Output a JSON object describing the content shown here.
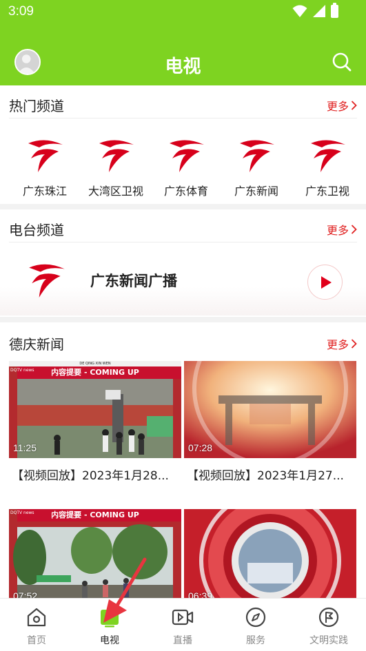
{
  "status": {
    "time": "3:09"
  },
  "header": {
    "title": "电视"
  },
  "hot_channels": {
    "title": "热门频道",
    "more": "更多",
    "items": [
      {
        "label": "广东珠江"
      },
      {
        "label": "大湾区卫视"
      },
      {
        "label": "广东体育"
      },
      {
        "label": "广东新闻"
      },
      {
        "label": "广东卫视"
      }
    ]
  },
  "radio": {
    "title": "电台频道",
    "more": "更多",
    "station": "广东新闻广播"
  },
  "news": {
    "title": "德庆新闻",
    "more": "更多",
    "banner_text": "内容提要 - COMING UP",
    "banner_small": "DE QING XIN WEN",
    "logo_text": "DQTV news",
    "items": [
      {
        "duration": "11:25",
        "title": "【视频回放】2023年1月28..."
      },
      {
        "duration": "07:28",
        "title": "【视频回放】2023年1月27..."
      },
      {
        "duration": "07:52",
        "title": ""
      },
      {
        "duration": "06:39",
        "title": ""
      }
    ]
  },
  "nav": {
    "items": [
      {
        "label": "首页"
      },
      {
        "label": "电视"
      },
      {
        "label": "直播"
      },
      {
        "label": "服务"
      },
      {
        "label": "文明实践"
      }
    ]
  },
  "colors": {
    "brand": "#7ed321",
    "accent": "#e02020",
    "gdtv_red": "#d7001b"
  }
}
